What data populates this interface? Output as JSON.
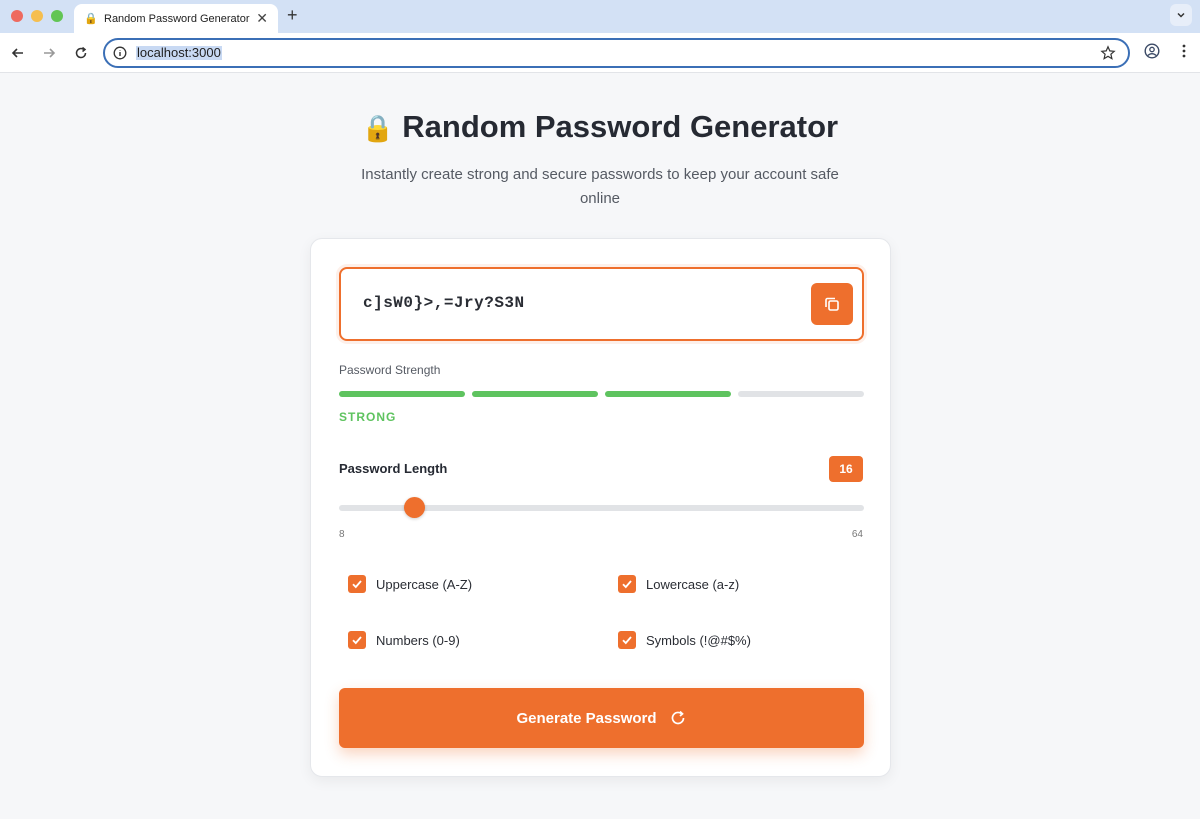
{
  "browser": {
    "tab_title": "Random Password Generator",
    "url": "localhost:3000"
  },
  "header": {
    "title": "Random Password Generator",
    "subtitle": "Instantly create strong and secure passwords to keep your account safe online"
  },
  "password": {
    "value": "c]sW0}>,=Jry?S3N"
  },
  "strength": {
    "label": "Password Strength",
    "value": "STRONG",
    "filled_segments": 3,
    "total_segments": 4,
    "color": "#5ec35f"
  },
  "length": {
    "label": "Password Length",
    "value": "16",
    "min": "8",
    "max": "64"
  },
  "options": [
    {
      "label": "Uppercase (A-Z)",
      "checked": true
    },
    {
      "label": "Lowercase (a-z)",
      "checked": true
    },
    {
      "label": "Numbers (0-9)",
      "checked": true
    },
    {
      "label": "Symbols (!@#$%)",
      "checked": true
    }
  ],
  "generate_button": {
    "label": "Generate Password"
  },
  "colors": {
    "accent": "#ee6f2d",
    "strong": "#5ec35f"
  }
}
